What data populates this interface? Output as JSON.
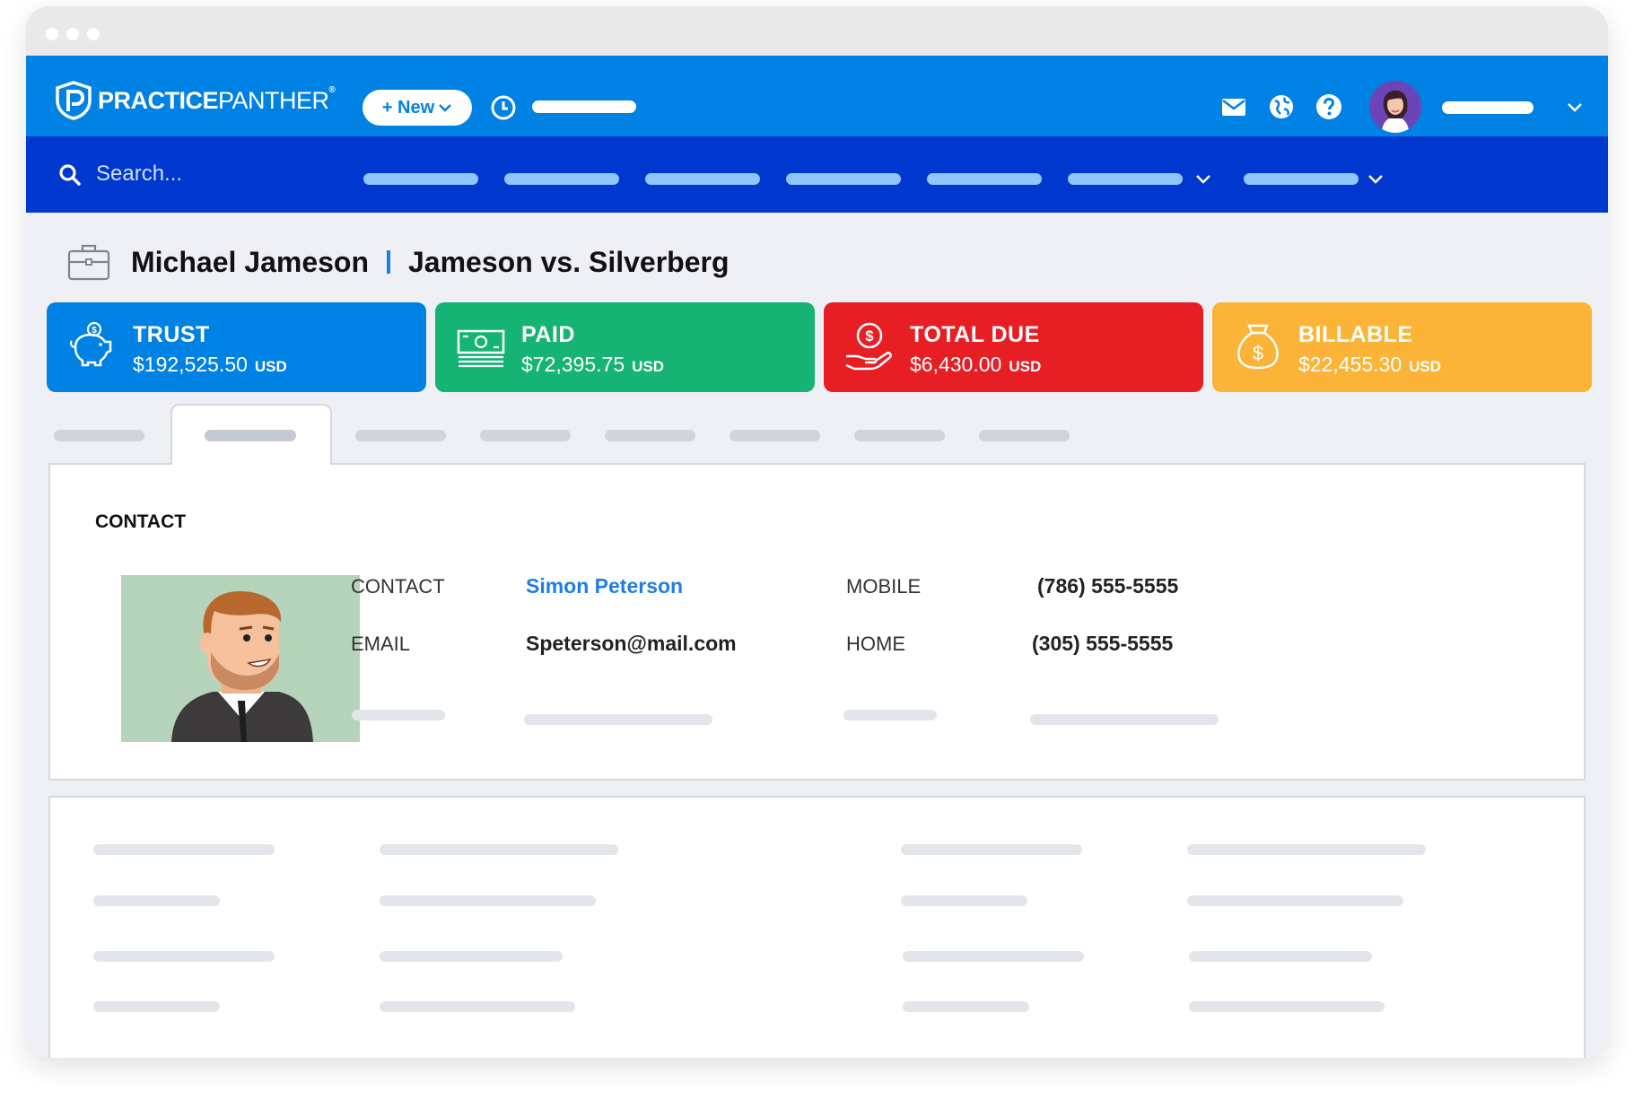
{
  "app": {
    "brand_bold": "PRACTICE",
    "brand_thin": "PANTHER",
    "new_button": "+ New"
  },
  "search": {
    "placeholder": "Search..."
  },
  "matter": {
    "client": "Michael Jameson",
    "case": "Jameson vs. Silverberg"
  },
  "cards": [
    {
      "label": "TRUST",
      "value": "$192,525.50",
      "currency": "USD",
      "color": "#0081e4",
      "icon": "piggy-bank-icon"
    },
    {
      "label": "PAID",
      "value": "$72,395.75",
      "currency": "USD",
      "color": "#15b374",
      "icon": "cash-icon"
    },
    {
      "label": "TOTAL DUE",
      "value": "$6,430.00",
      "currency": "USD",
      "color": "#e81e25",
      "icon": "hand-coin-icon"
    },
    {
      "label": "BILLABLE",
      "value": "$22,455.30",
      "currency": "USD",
      "color": "#fbb437",
      "icon": "money-bag-icon"
    }
  ],
  "contact": {
    "section_title": "CONTACT",
    "contact_label": "CONTACT",
    "contact_value": "Simon Peterson",
    "email_label": "EMAIL",
    "email_value": "Speterson@mail.com",
    "mobile_label": "MOBILE",
    "mobile_value": "(786) 555-5555",
    "home_label": "HOME",
    "home_value": "(305) 555-5555"
  },
  "colors": {
    "topbar": "#0081e4",
    "navbar": "#0038cf",
    "link": "#1f7fe0"
  }
}
